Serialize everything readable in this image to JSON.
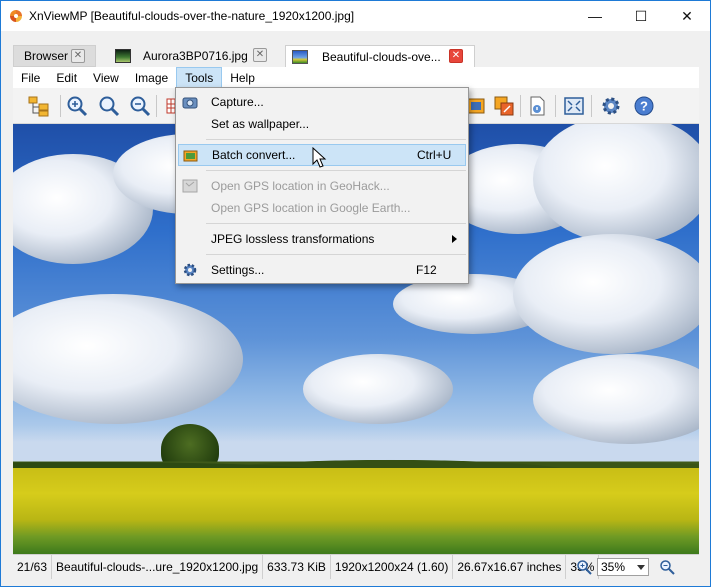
{
  "window": {
    "title": "XnViewMP [Beautiful-clouds-over-the-nature_1920x1200.jpg]",
    "minimize": "—",
    "maximize": "☐",
    "close": "✕"
  },
  "tabs": [
    {
      "label": "Browser",
      "close": "✕"
    },
    {
      "label": "Aurora3BP0716.jpg",
      "close": "✕"
    },
    {
      "label": "Beautiful-clouds-ove...",
      "close": "✕"
    }
  ],
  "menu": [
    "File",
    "Edit",
    "View",
    "Image",
    "Tools",
    "Help"
  ],
  "tools_menu": {
    "capture": "Capture...",
    "wallpaper": "Set as wallpaper...",
    "batch_convert": "Batch convert...",
    "batch_convert_shortcut": "Ctrl+U",
    "gps_geohack": "Open GPS location in GeoHack...",
    "gps_earth": "Open GPS location in Google Earth...",
    "jpeg_lossless": "JPEG lossless transformations",
    "settings": "Settings...",
    "settings_shortcut": "F12"
  },
  "status": {
    "index": "21/63",
    "filename": "Beautiful-clouds-...ure_1920x1200.jpg",
    "filesize": "633.73 KiB",
    "dimensions": "1920x1200x24 (1.60)",
    "print_size": "26.67x16.67 inches",
    "zoom": "35%",
    "zoom_value": "35%"
  },
  "colors": {
    "accent": "#1e7ad6",
    "menu_highlight": "#cce4f7",
    "tab_close_active": "#e8463b"
  }
}
